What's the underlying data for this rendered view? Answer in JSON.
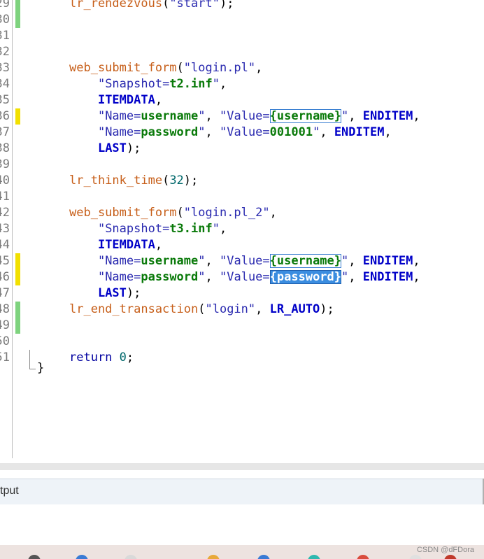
{
  "editor": {
    "line_numbers": [
      "29",
      "30",
      "31",
      "32",
      "33",
      "34",
      "35",
      "36",
      "37",
      "38",
      "39",
      "40",
      "41",
      "42",
      "43",
      "44",
      "45",
      "46",
      "47",
      "48",
      "49",
      "50",
      "51"
    ],
    "lines": [
      [
        {
          "c": "fn",
          "t": "lr_rendezvous"
        },
        {
          "c": "plain",
          "t": "("
        },
        {
          "c": "str",
          "t": "\"start\""
        },
        {
          "c": "plain",
          "t": ");"
        }
      ],
      [],
      [],
      [],
      [
        {
          "c": "fn",
          "t": "web_submit_form"
        },
        {
          "c": "plain",
          "t": "("
        },
        {
          "c": "str",
          "t": "\"login.pl\""
        },
        {
          "c": "plain",
          "t": ","
        }
      ],
      [
        {
          "c": "plain",
          "t": "    "
        },
        {
          "c": "str",
          "t": "\"Snapshot="
        },
        {
          "c": "pv",
          "t": "t2.inf"
        },
        {
          "c": "str",
          "t": "\""
        },
        {
          "c": "plain",
          "t": ","
        }
      ],
      [
        {
          "c": "plain",
          "t": "    "
        },
        {
          "c": "kw",
          "t": "ITEMDATA"
        },
        {
          "c": "plain",
          "t": ","
        }
      ],
      [
        {
          "c": "plain",
          "t": "    "
        },
        {
          "c": "str",
          "t": "\"Name="
        },
        {
          "c": "pv",
          "t": "username"
        },
        {
          "c": "str",
          "t": "\""
        },
        {
          "c": "plain",
          "t": ", "
        },
        {
          "c": "str",
          "t": "\"Value="
        },
        {
          "c": "param",
          "t": "{username}"
        },
        {
          "c": "str",
          "t": "\""
        },
        {
          "c": "plain",
          "t": ", "
        },
        {
          "c": "kw",
          "t": "ENDITEM"
        },
        {
          "c": "plain",
          "t": ","
        }
      ],
      [
        {
          "c": "plain",
          "t": "    "
        },
        {
          "c": "str",
          "t": "\"Name="
        },
        {
          "c": "pv",
          "t": "password"
        },
        {
          "c": "str",
          "t": "\""
        },
        {
          "c": "plain",
          "t": ", "
        },
        {
          "c": "str",
          "t": "\"Value="
        },
        {
          "c": "pv",
          "t": "001001"
        },
        {
          "c": "str",
          "t": "\""
        },
        {
          "c": "plain",
          "t": ", "
        },
        {
          "c": "kw",
          "t": "ENDITEM"
        },
        {
          "c": "plain",
          "t": ","
        }
      ],
      [
        {
          "c": "plain",
          "t": "    "
        },
        {
          "c": "kw",
          "t": "LAST"
        },
        {
          "c": "plain",
          "t": ");"
        }
      ],
      [],
      [
        {
          "c": "fn",
          "t": "lr_think_time"
        },
        {
          "c": "plain",
          "t": "("
        },
        {
          "c": "num",
          "t": "32"
        },
        {
          "c": "plain",
          "t": ");"
        }
      ],
      [],
      [
        {
          "c": "fn",
          "t": "web_submit_form"
        },
        {
          "c": "plain",
          "t": "("
        },
        {
          "c": "str",
          "t": "\"login.pl_2\""
        },
        {
          "c": "plain",
          "t": ","
        }
      ],
      [
        {
          "c": "plain",
          "t": "    "
        },
        {
          "c": "str",
          "t": "\"Snapshot="
        },
        {
          "c": "pv",
          "t": "t3.inf"
        },
        {
          "c": "str",
          "t": "\""
        },
        {
          "c": "plain",
          "t": ","
        }
      ],
      [
        {
          "c": "plain",
          "t": "    "
        },
        {
          "c": "kw",
          "t": "ITEMDATA"
        },
        {
          "c": "plain",
          "t": ","
        }
      ],
      [
        {
          "c": "plain",
          "t": "    "
        },
        {
          "c": "str",
          "t": "\"Name="
        },
        {
          "c": "pv",
          "t": "username"
        },
        {
          "c": "str",
          "t": "\""
        },
        {
          "c": "plain",
          "t": ", "
        },
        {
          "c": "str",
          "t": "\"Value="
        },
        {
          "c": "param",
          "t": "{username}"
        },
        {
          "c": "str",
          "t": "\""
        },
        {
          "c": "plain",
          "t": ", "
        },
        {
          "c": "kw",
          "t": "ENDITEM"
        },
        {
          "c": "plain",
          "t": ","
        }
      ],
      [
        {
          "c": "plain",
          "t": "    "
        },
        {
          "c": "str",
          "t": "\"Name="
        },
        {
          "c": "pv",
          "t": "password"
        },
        {
          "c": "str",
          "t": "\""
        },
        {
          "c": "plain",
          "t": ", "
        },
        {
          "c": "str",
          "t": "\"Value="
        },
        {
          "c": "param selected",
          "t": "{password}"
        },
        {
          "c": "str",
          "t": "\""
        },
        {
          "c": "plain",
          "t": ", "
        },
        {
          "c": "kw",
          "t": "ENDITEM"
        },
        {
          "c": "plain",
          "t": ","
        }
      ],
      [
        {
          "c": "plain",
          "t": "    "
        },
        {
          "c": "kw",
          "t": "LAST"
        },
        {
          "c": "plain",
          "t": ");"
        }
      ],
      [
        {
          "c": "fn",
          "t": "lr_end_transaction"
        },
        {
          "c": "plain",
          "t": "("
        },
        {
          "c": "str",
          "t": "\"login\""
        },
        {
          "c": "plain",
          "t": ", "
        },
        {
          "c": "kw",
          "t": "LR_AUTO"
        },
        {
          "c": "plain",
          "t": ");"
        }
      ],
      [],
      [],
      [
        {
          "c": "kwp",
          "t": "return"
        },
        {
          "c": "plain",
          "t": " "
        },
        {
          "c": "num",
          "t": "0"
        },
        {
          "c": "plain",
          "t": ";"
        }
      ]
    ],
    "closing_brace": "}",
    "change_marks": [
      {
        "line_index": 0,
        "color": "#7ed37e"
      },
      {
        "line_index": 1,
        "color": "#7ed37e"
      },
      {
        "line_index": 7,
        "color": "#f2e000"
      },
      {
        "line_index": 16,
        "color": "#f2e000"
      },
      {
        "line_index": 17,
        "color": "#f2e000"
      },
      {
        "line_index": 19,
        "color": "#7ed37e"
      },
      {
        "line_index": 20,
        "color": "#7ed37e"
      }
    ]
  },
  "output_panel": {
    "title": "tput"
  },
  "taskbar": {
    "icons": [
      {
        "name": "browser-icon",
        "color": "#555555"
      },
      {
        "name": "files-icon",
        "color": "#3a7bd5"
      },
      {
        "name": "app-icon",
        "color": "#d9d9d9"
      },
      {
        "name": "folder-icon",
        "color": "#e8a93a"
      },
      {
        "name": "settings-icon",
        "color": "#3a7bd5"
      },
      {
        "name": "chat-icon",
        "color": "#2fb9b0"
      },
      {
        "name": "chrome-icon",
        "color": "#d94c3d"
      },
      {
        "name": "doc-icon",
        "color": "#e0e0e0"
      },
      {
        "name": "pinned-icon",
        "color": "#c0392b"
      }
    ]
  },
  "watermark": "CSDN @dFDora"
}
